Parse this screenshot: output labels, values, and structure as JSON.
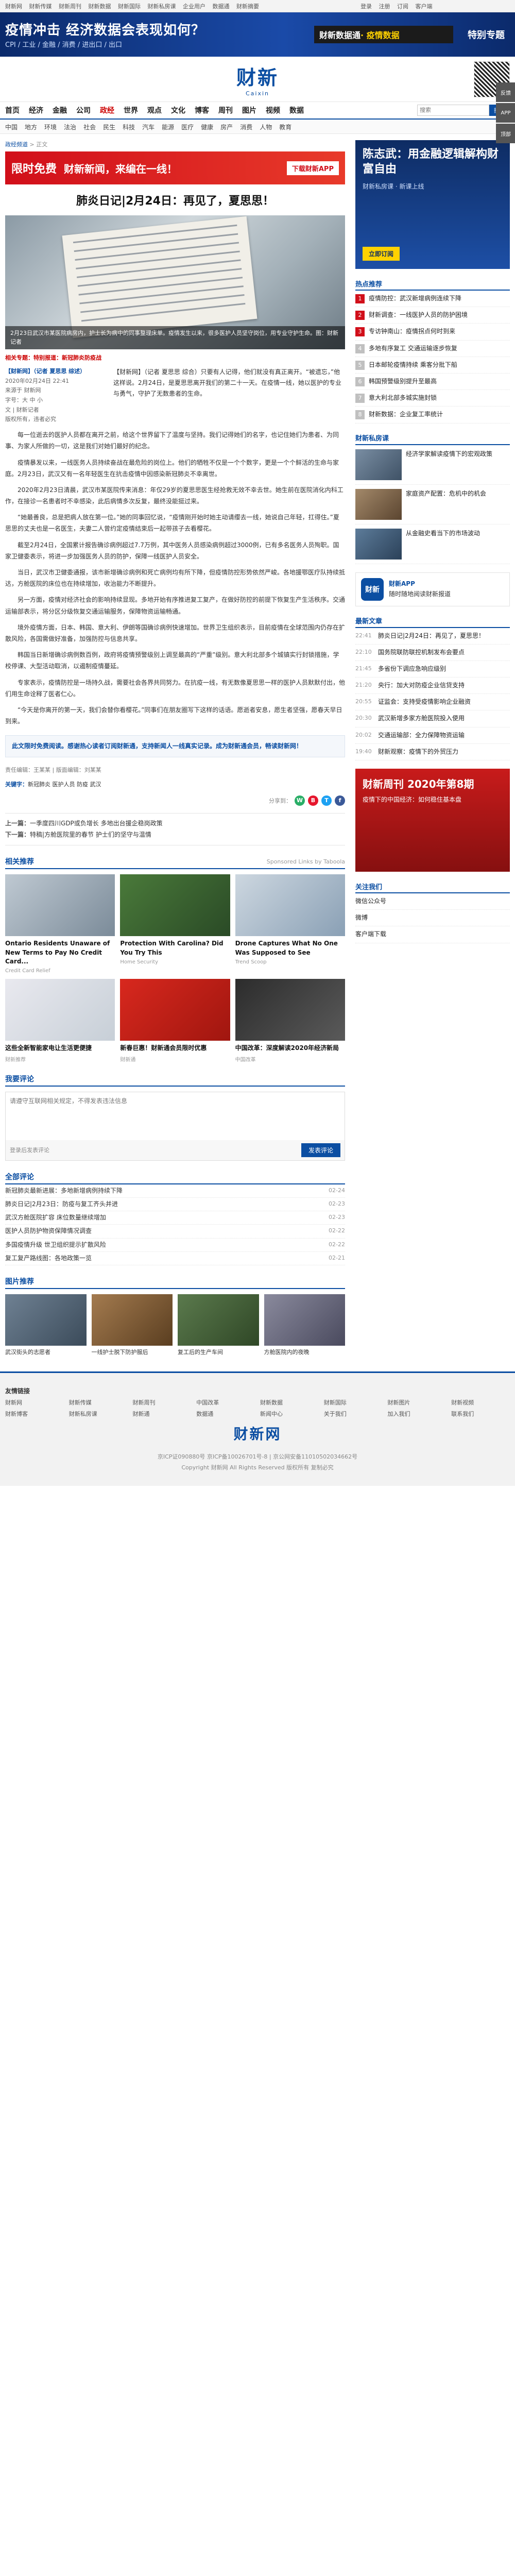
{
  "topbar": {
    "links": [
      "财新网",
      "财新传媒",
      "财新周刊",
      "财新数据",
      "财新国际",
      "财新私房课",
      "企业用户",
      "数据通",
      "财新摘要"
    ],
    "right": [
      "登录",
      "注册",
      "订阅",
      "客户端"
    ]
  },
  "banner": {
    "title": "疫情冲击 经济数据会表现如何？",
    "sub": "CPI / 工业 / 金融 / 消费 / 进出口 / 出口",
    "right_label": "财新数据通",
    "right_highlight": " · 疫情数据",
    "tag": "特别专题"
  },
  "logo": {
    "cn": "财新",
    "en": "Caixin"
  },
  "mainnav": {
    "items": [
      "首页",
      "经济",
      "金融",
      "公司",
      "政经",
      "世界",
      "观点",
      "文化",
      "博客",
      "周刊",
      "图片",
      "视频",
      "数据"
    ],
    "active_index": 4,
    "search_placeholder": "搜索",
    "search_btn": "搜索"
  },
  "subnav": {
    "items": [
      "中国",
      "地方",
      "环境",
      "法治",
      "社会",
      "民生",
      "科技",
      "汽车",
      "能源",
      "医疗",
      "健康",
      "房产",
      "消费",
      "人物",
      "教育"
    ]
  },
  "crumb": {
    "home": "政经频道",
    "sep": " > ",
    "current": "正文"
  },
  "adstrip": {
    "s1": "限时免费",
    "s2": "财新新闻，来编在一线！",
    "s3": "下载财新APP"
  },
  "article": {
    "title": "肺炎日记|2月24日：再见了，夏思思！",
    "hero_caption": "2月23日武汉市某医院病房内，护士长为病中的同事整理床单。疫情发生以来，很多医护人员坚守岗位，用专业守护生命。图：财新记者",
    "red_note": "相关专题",
    "red_note_text": "特别报道：新冠肺炎防疫战",
    "meta": {
      "author": "【财新网】（记者 夏思思 综述）",
      "lines": [
        "2020年02月24日 22:41",
        "来源于 财新网",
        "字号：大 中 小",
        "文 | 财新记者",
        "版权所有，违者必究"
      ]
    },
    "summary": "【财新网】（记者 夏思思 综合）只要有人记得，他们就没有真正离开。“被遗忘，”他这样说。2月24日，是夏思思离开我们的第二十一天。在疫情一线，她以医护的专业与勇气，守护了无数患者的生命。",
    "paragraphs": [
      "每一位逝去的医护人员都在离开之前，给这个世界留下了温度与坚持。我们记得她们的名字，也记住她们为患者、为同事、为家人所做的一切，这是我们对她们最好的纪念。",
      "疫情暴发以来，一线医务人员持续奋战在最危险的岗位上。他们的牺牲不仅是一个个数字，更是一个个鲜活的生命与家庭。2月23日，武汉又有一名年轻医生在抗击疫情中因感染新冠肺炎不幸离世。",
      "2020年2月23日清晨，武汉市某医院传来消息：年仅29岁的夏思思医生经抢救无效不幸去世。她生前在医院消化内科工作，在接诊一名患者时不幸感染，此后病情多次反复，最终没能挺过来。",
      "“她最善良，总是把病人放在第一位。”她的同事回忆说，“疫情刚开始时她主动请缨去一线，她说自己年轻，扛得住。”夏思思的丈夫也是一名医生，夫妻二人曾约定疫情结束后一起带孩子去看樱花。",
      "截至2月24日，全国累计报告确诊病例超过7.7万例，其中医务人员感染病例超过3000例，已有多名医务人员殉职。国家卫健委表示，将进一步加强医务人员的防护，保障一线医护人员安全。",
      "当日，武汉市卫健委通报，该市新增确诊病例和死亡病例均有所下降，但疫情防控形势依然严峻。各地援鄂医疗队持续抵达，方舱医院的床位也在持续增加，收治能力不断提升。",
      "另一方面，疫情对经济社会的影响持续显现。多地开始有序推进复工复产，在做好防控的前提下恢复生产生活秩序。交通运输部表示，将分区分级恢复交通运输服务，保障物资运输畅通。",
      "境外疫情方面，日本、韩国、意大利、伊朗等国确诊病例快速增加。世界卫生组织表示，目前疫情在全球范围内仍存在扩散风险，各国需做好准备，加强防控与信息共享。",
      "韩国当日新增确诊病例数百例，政府将疫情预警级别上调至最高的“严重”级别。意大利北部多个城镇实行封锁措施，学校停课、大型活动取消，以遏制疫情蔓延。",
      "专家表示，疫情防控是一场持久战，需要社会各界共同努力。在抗疫一线，有无数像夏思思一样的医护人员默默付出，他们用生命诠释了医者仁心。",
      "“今天是你离开的第一天，我们会替你看樱花。”同事们在朋友圈写下这样的话语。愿逝者安息，愿生者坚强，愿春天早日到来。"
    ],
    "statement": "此文限时免费阅读。感谢热心读者订阅财新通，支持新闻人一线真实记录。成为财新通会员，畅读财新网！",
    "editor": "责任编辑：王某某 | 版面编辑：刘某某",
    "keyword_label": "关键字：",
    "keywords": "新冠肺炎 医护人员 防疫 武汉",
    "share_label": "分享到："
  },
  "prevnext": {
    "prev_label": "上一篇：",
    "prev": "一季度四川GDP或负增长 多地出台援企稳岗政策",
    "next_label": "下一篇：",
    "next": "特稿|方舱医院里的春节 护士们的坚守与温情"
  },
  "recommend": {
    "head": "相关推荐",
    "more": "Sponsored Links by Taboola",
    "cards": [
      {
        "cap": "Ontario Residents Unaware of New Terms to Pay No Credit Card...",
        "src": "Credit Card Relief"
      },
      {
        "cap": "Protection With Carolina? Did You Try This",
        "src": "Home Security"
      },
      {
        "cap": "Drone Captures What No One Was Supposed to See",
        "src": "Trend Scoop"
      },
      {
        "cap": "这些全新智能家电让生活更便捷",
        "src": "财新推荐"
      },
      {
        "cap": "新春巨惠！财新通会员限时优惠",
        "src": "财新通"
      },
      {
        "cap": "中国改革：深度解读2020年经济新局",
        "src": "中国改革"
      }
    ]
  },
  "comment": {
    "head": "我要评论",
    "placeholder": "请遵守互联网相关规定，不得发表违法信息",
    "tip": "登录后发表评论",
    "submit": "发表评论"
  },
  "newslist": {
    "head": "全部评论",
    "rows": [
      {
        "t": "新冠肺炎最新进展：多地新增病例持续下降",
        "d": "02-24"
      },
      {
        "t": "肺炎日记|2月23日：防疫与复工齐头并进",
        "d": "02-23"
      },
      {
        "t": "武汉方舱医院扩容 床位数量继续增加",
        "d": "02-23"
      },
      {
        "t": "医护人员防护物资保障情况调查",
        "d": "02-22"
      },
      {
        "t": "多国疫情升级 世卫组织提示扩散风险",
        "d": "02-22"
      },
      {
        "t": "复工复产路线图：各地政策一览",
        "d": "02-21"
      }
    ]
  },
  "pictures": {
    "head": "图片推荐",
    "items": [
      "武汉街头的志愿者",
      "一线护士脱下防护服后",
      "复工后的生产车间",
      "方舱医院内的夜晚"
    ]
  },
  "right": {
    "ad1": {
      "t1": "陈志武：用金融逻辑解构财富自由",
      "t2": "财新私房课 · 新课上线",
      "btn": "立即订阅"
    },
    "hot_head": "热点推荐",
    "hot": [
      "疫情防控：武汉新增病例连续下降",
      "财新调查：一线医护人员的防护困境",
      "专访钟南山：疫情拐点何时到来",
      "多地有序复工 交通运输逐步恢复",
      "日本邮轮疫情持续 乘客分批下船",
      "韩国预警级别提升至最高",
      "意大利北部多城实施封锁",
      "财新数据：企业复工率统计"
    ],
    "feature_head": "财新私房课",
    "features": [
      "经济学家解读疫情下的宏观政策",
      "家庭资产配置：危机中的机会",
      "从金融史看当下的市场波动"
    ],
    "app": {
      "name": "财新",
      "l1": "财新APP",
      "l2": "随时随地阅读财新报道"
    },
    "latest_head": "最新文章",
    "latest": [
      {
        "tm": "22:41",
        "t": "肺炎日记|2月24日：再见了，夏思思！"
      },
      {
        "tm": "22:10",
        "t": "国务院联防联控机制发布会要点"
      },
      {
        "tm": "21:45",
        "t": "多省份下调应急响应级别"
      },
      {
        "tm": "21:20",
        "t": "央行：加大对防疫企业信贷支持"
      },
      {
        "tm": "20:55",
        "t": "证监会：支持受疫情影响企业融资"
      },
      {
        "tm": "20:30",
        "t": "武汉新增多家方舱医院投入使用"
      },
      {
        "tm": "20:02",
        "t": "交通运输部：全力保障物资运输"
      },
      {
        "tm": "19:40",
        "t": "财新观察：疫情下的外贸压力"
      }
    ],
    "ad2": {
      "t1": "财新周刊 2020年第8期",
      "t2": "疫情下的中国经济：如何稳住基本盘"
    },
    "follow_head": "关注我们",
    "follow": [
      "微信公众号",
      "微博",
      "客户端下载"
    ]
  },
  "float": [
    "反馈",
    "APP",
    "顶部"
  ],
  "footer": {
    "links_title": "友情链接",
    "links": [
      "财新网",
      "财新传媒",
      "财新周刊",
      "中国改革",
      "财新数据",
      "财新国际",
      "财新图片",
      "财新视频",
      "财新博客",
      "财新私房课",
      "财新通",
      "数据通",
      "新闻中心",
      "关于我们",
      "加入我们",
      "联系我们"
    ],
    "logo": "财新网",
    "copy": [
      "京ICP证090880号 京ICP备10026701号-8 | 京公网安备11010502034662号",
      "Copyright 财新网 All Rights Reserved 版权所有 复制必究"
    ]
  }
}
